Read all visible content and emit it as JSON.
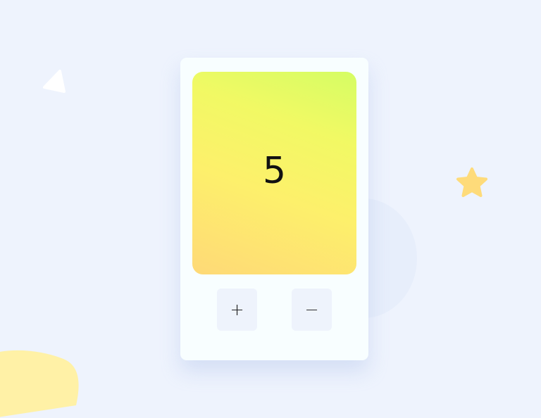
{
  "counter": {
    "value": "5"
  },
  "controls": {
    "increment_label": "+",
    "decrement_label": "−"
  },
  "colors": {
    "background": "#eef3fd",
    "card": "#f8feff",
    "display_gradient_top": "#d5fd64",
    "display_gradient_bottom": "#fed977",
    "star": "#fedb7a",
    "blob": "#fff1a6",
    "triangle": "#ffffff"
  },
  "decorations": {
    "icons": [
      "triangle-icon",
      "star-icon"
    ]
  }
}
